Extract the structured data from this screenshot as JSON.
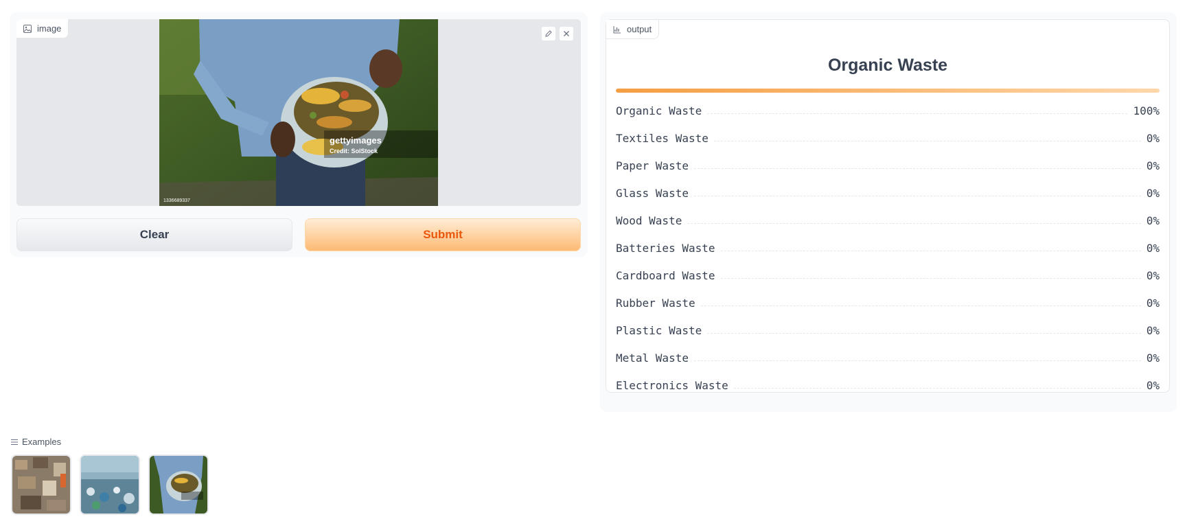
{
  "input": {
    "label": "image",
    "image_alt": "Person holding bin of food scraps",
    "watermark": {
      "brand": "gettyimages",
      "credit": "Credit: SolStock",
      "id": "1336689337"
    },
    "tools": {
      "edit": "pencil-icon",
      "clear": "close-icon"
    }
  },
  "buttons": {
    "clear": "Clear",
    "submit": "Submit"
  },
  "output": {
    "label": "output",
    "title": "Organic Waste",
    "top_confidence": 1.0,
    "rows": [
      {
        "label": "Organic Waste",
        "value": "100%"
      },
      {
        "label": "Textiles Waste",
        "value": "0%"
      },
      {
        "label": "Paper Waste",
        "value": "0%"
      },
      {
        "label": "Glass Waste",
        "value": "0%"
      },
      {
        "label": "Wood Waste",
        "value": "0%"
      },
      {
        "label": "Batteries Waste",
        "value": "0%"
      },
      {
        "label": "Cardboard Waste",
        "value": "0%"
      },
      {
        "label": "Rubber Waste",
        "value": "0%"
      },
      {
        "label": "Plastic Waste",
        "value": "0%"
      },
      {
        "label": "Metal Waste",
        "value": "0%"
      },
      {
        "label": "Electronics Waste",
        "value": "0%"
      }
    ]
  },
  "examples": {
    "label": "Examples",
    "items": [
      "mixed-waste-pile",
      "plastic-waste-beach",
      "organic-food-scraps"
    ]
  },
  "colors": {
    "accent": "#f97316",
    "bar_start": "#f59e42",
    "bar_end": "#fed7aa"
  }
}
